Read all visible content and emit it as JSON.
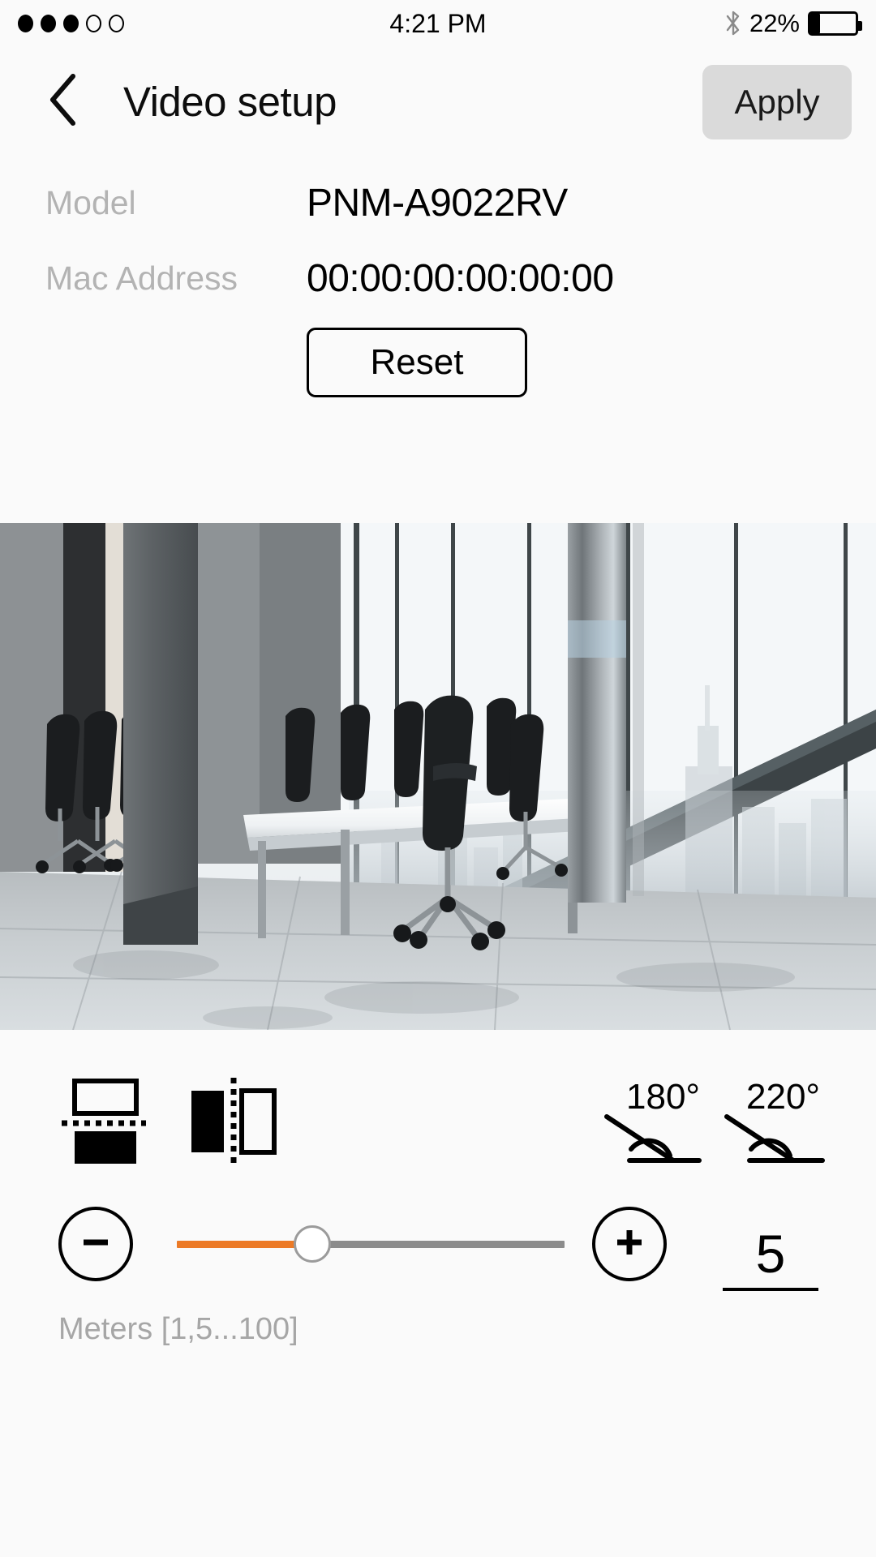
{
  "status_bar": {
    "signal_dots": [
      "filled",
      "filled",
      "filled",
      "empty",
      "empty"
    ],
    "time": "4:21 PM",
    "bluetooth_icon": "bluetooth-icon",
    "battery_percent": "22%",
    "battery_level": 22
  },
  "header": {
    "back_icon": "chevron-left-icon",
    "title": "Video setup",
    "apply_label": "Apply"
  },
  "info": {
    "model_label": "Model",
    "model_value": "PNM-A9022RV",
    "mac_label": "Mac Address",
    "mac_value": "00:00:00:00:00:00",
    "reset_label": "Reset"
  },
  "preview": {
    "alt": "conference-room-camera-preview"
  },
  "controls": {
    "flip_horizontal_icon": "flip-horizontal-icon",
    "flip_vertical_icon": "flip-vertical-icon",
    "angle_180_label": "180°",
    "angle_220_label": "220°",
    "angle_180_icon": "angle-icon",
    "angle_220_icon": "angle-icon",
    "decrement_icon": "minus-circle-icon",
    "increment_icon": "plus-circle-icon",
    "slider_value": 5,
    "slider_min": 1,
    "slider_max": 100,
    "slider_fill_percent": 35,
    "value_display": "5",
    "range_label": "Meters [1,5...100]"
  },
  "colors": {
    "accent_orange": "#ec7a26",
    "track_gray": "#8c8c8c",
    "apply_bg": "#dadada",
    "label_gray": "#b3b3b3",
    "page_bg": "#fafafa"
  }
}
